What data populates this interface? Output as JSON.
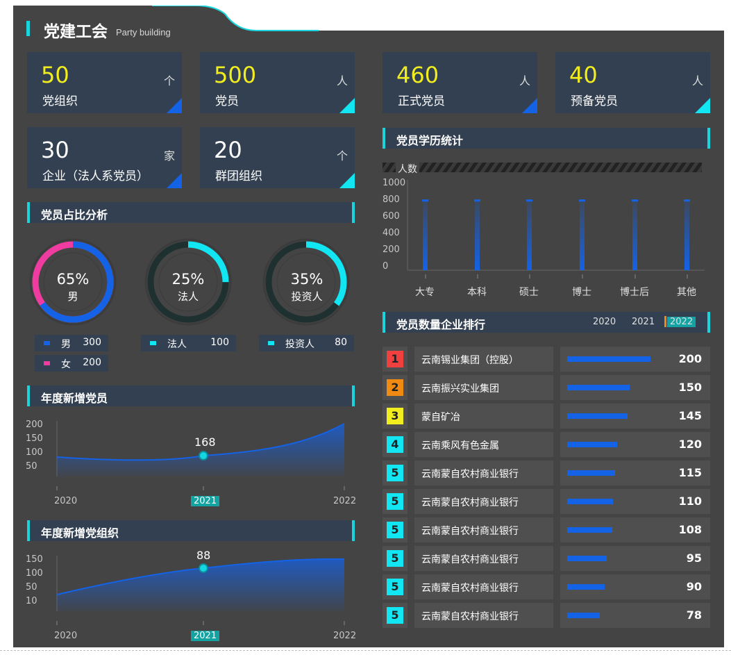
{
  "header": {
    "title": "党建工会",
    "subtitle": "Party building"
  },
  "stats": [
    {
      "value": "50",
      "unit": "个",
      "label": "党组织"
    },
    {
      "value": "500",
      "unit": "人",
      "label": "党员"
    },
    {
      "value": "460",
      "unit": "人",
      "label": "正式党员"
    },
    {
      "value": "40",
      "unit": "人",
      "label": "预备党员"
    },
    {
      "value": "30",
      "unit": "家",
      "label": "企业（法人系党员）"
    },
    {
      "value": "20",
      "unit": "个",
      "label": "群团组织"
    }
  ],
  "ratio_section": {
    "title": "党员占比分析",
    "donuts": [
      {
        "percent": "65%",
        "label": "男",
        "fraction": 0.65
      },
      {
        "percent": "25%",
        "label": "法人",
        "fraction": 0.25
      },
      {
        "percent": "35%",
        "label": "投资人",
        "fraction": 0.35
      }
    ],
    "legend": [
      {
        "name": "男",
        "value": "300",
        "color": "#1462e6"
      },
      {
        "name": "女",
        "value": "200",
        "color": "#f03ca0"
      },
      {
        "name": "法人",
        "value": "100",
        "color": "#12e6f2"
      },
      {
        "name": "投资人",
        "value": "80",
        "color": "#12e6f2"
      }
    ]
  },
  "members_chart": {
    "title": "年度新增党员",
    "chart_data": {
      "type": "area",
      "x": [
        "2020",
        "2021",
        "2022"
      ],
      "y_ticks": [
        "200",
        "150",
        "100",
        "50"
      ],
      "highlight_x": "2021",
      "highlight_label": "168"
    }
  },
  "orgs_chart": {
    "title": "年度新增党组织",
    "chart_data": {
      "type": "area",
      "x": [
        "2020",
        "2021",
        "2022"
      ],
      "y_ticks": [
        "150",
        "100",
        "50",
        "10"
      ],
      "highlight_x": "2021",
      "highlight_label": "88"
    }
  },
  "edu_chart": {
    "title": "党员学历统计",
    "chart_data": {
      "type": "bar",
      "ylabel": "人数",
      "y_ticks": [
        "1000",
        "800",
        "600",
        "400",
        "200",
        "0"
      ],
      "ylim": [
        0,
        1000
      ],
      "categories": [
        "大专",
        "本科",
        "硕士",
        "博士",
        "博士后",
        "其他"
      ],
      "values": [
        800,
        800,
        800,
        800,
        800,
        800
      ]
    }
  },
  "ranking": {
    "title": "党员数量企业排行",
    "years": [
      "2020",
      "2021",
      "2022"
    ],
    "active_year": "2022",
    "rows": [
      {
        "rank": "1",
        "name": "云南锡业集团（控股）",
        "value": "200",
        "num": 200,
        "color": "#f04040"
      },
      {
        "rank": "2",
        "name": "云南振兴实业集团",
        "value": "150",
        "num": 150,
        "color": "#f08a10"
      },
      {
        "rank": "3",
        "name": "蒙自矿冶",
        "value": "145",
        "num": 145,
        "color": "#f2ee1e"
      },
      {
        "rank": "4",
        "name": "云南乘风有色金属",
        "value": "120",
        "num": 120,
        "color": "#12e6f2"
      },
      {
        "rank": "5",
        "name": "云南蒙自农村商业银行",
        "value": "115",
        "num": 115,
        "color": "#12e6f2"
      },
      {
        "rank": "5",
        "name": "云南蒙自农村商业银行",
        "value": "110",
        "num": 110,
        "color": "#12e6f2"
      },
      {
        "rank": "5",
        "name": "云南蒙自农村商业银行",
        "value": "108",
        "num": 108,
        "color": "#12e6f2"
      },
      {
        "rank": "5",
        "name": "云南蒙自农村商业银行",
        "value": "95",
        "num": 95,
        "color": "#12e6f2"
      },
      {
        "rank": "5",
        "name": "云南蒙自农村商业银行",
        "value": "90",
        "num": 90,
        "color": "#12e6f2"
      },
      {
        "rank": "5",
        "name": "云南蒙自农村商业银行",
        "value": "78",
        "num": 78,
        "color": "#12e6f2"
      }
    ]
  }
}
